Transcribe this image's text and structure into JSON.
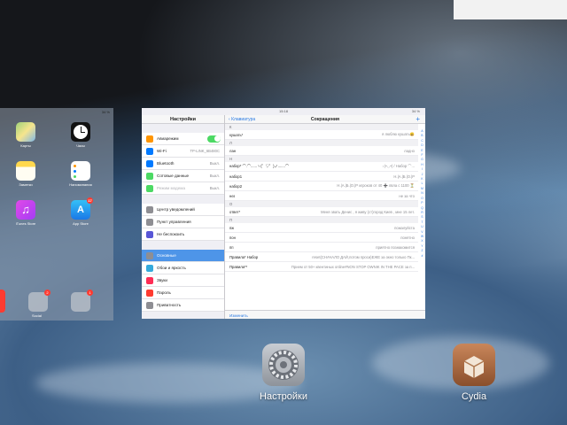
{
  "home_preview": {
    "status_time": "34 %",
    "apps": [
      {
        "label": "Карты",
        "icon": "maps-icon"
      },
      {
        "label": "Часы",
        "icon": "clock-icon"
      },
      {
        "label": "Заметки",
        "icon": "notes-icon"
      },
      {
        "label": "Напоминания",
        "icon": "reminders-icon"
      },
      {
        "label": "iTunes Store",
        "icon": "itunes-icon"
      },
      {
        "label": "App Store",
        "icon": "appstore-icon",
        "badge": "17"
      }
    ],
    "folders": [
      {
        "label": "Social",
        "badge": "2"
      },
      {
        "label": "",
        "badge": "1"
      }
    ]
  },
  "settings_preview": {
    "status_time": "15:18",
    "status_right": "34 %",
    "sidebar_title": "Настройки",
    "groups": [
      [
        {
          "label": "Авиарежим",
          "value": "",
          "toggle": true,
          "color": "#ff9500"
        },
        {
          "label": "Wi-Fi",
          "value": "TP-LINK_6B480C",
          "color": "#007aff"
        },
        {
          "label": "Bluetooth",
          "value": "Выкл.",
          "color": "#007aff"
        },
        {
          "label": "Сотовые данные",
          "value": "Выкл.",
          "color": "#4cd964"
        },
        {
          "label": "Режим модема",
          "value": "Выкл.",
          "color": "#4cd964",
          "dim": true
        }
      ],
      [
        {
          "label": "Центр уведомлений",
          "value": "",
          "color": "#8e8e93"
        },
        {
          "label": "Пункт управления",
          "value": "",
          "color": "#8e8e93"
        },
        {
          "label": "Не беспокоить",
          "value": "",
          "color": "#5856d6"
        }
      ],
      [
        {
          "label": "Основные",
          "value": "",
          "color": "#8e8e93",
          "active": true
        },
        {
          "label": "Обои и яркость",
          "value": "",
          "color": "#34aadc"
        },
        {
          "label": "Звуки",
          "value": "",
          "color": "#ff2d55"
        },
        {
          "label": "Пароль",
          "value": "",
          "color": "#ff3b30"
        },
        {
          "label": "Приватность",
          "value": "",
          "color": "#8e8e93"
        }
      ]
    ],
    "detail": {
      "back_label": "Клавиатура",
      "title": "Сокращения",
      "add_label": "+",
      "sections": [
        {
          "header": "К",
          "rows": [
            {
              "phrase": "кушать*",
              "shortcut": "я люблю кушать😀"
            }
          ]
        },
        {
          "header": "Л",
          "rows": [
            {
              "phrase": "лан",
              "shortcut": "ладно"
            }
          ]
        },
        {
          "header": "Н",
          "rows": [
            {
              "phrase": "набор* ⌒.⌒......ヽ(゜▽゜)ノ.......⌒",
              "shortcut": "\\ (•◡•) / Набор ⌒..."
            },
            {
              "phrase": "набор1",
              "shortcut": "Н.|А.|Б.|О.|Р"
            },
            {
              "phrase": "набор2",
              "shortcut": "Н.|А.|Б.|О.|Р игроков от 40 ➕ лвла с 1100 ⏳"
            },
            {
              "phrase": "нез",
              "shortcut": "не за что"
            }
          ]
        },
        {
          "header": "О",
          "rows": [
            {
              "phrase": "ответ*",
              "shortcut": "Меня звать Денис , я живу (ст)город Киев , мне 15 лет."
            }
          ]
        },
        {
          "header": "П",
          "rows": [
            {
              "phrase": "пж",
              "shortcut": "пожалуйста"
            },
            {
              "phrase": "пон",
              "shortcut": "понятно"
            },
            {
              "phrase": "пп",
              "shortcut": "приятно познакомится"
            },
            {
              "phrase": "Правила* Набор",
              "shortcut": "reset(СНАЧАЛО ДАЙ,потом проси)ЕЖЕ за окно только  Пк..."
            },
            {
              "phrase": "Правила**",
              "shortcut": "Прием от 50+ квентиных online#NON STOP OWNIK IN THE PACE за п..."
            }
          ]
        }
      ],
      "index_letters": [
        "A",
        "B",
        "C",
        "D",
        "E",
        "F",
        "G",
        "H",
        "I",
        "J",
        "K",
        "L",
        "M",
        "N",
        "O",
        "P",
        "Q",
        "R",
        "S",
        "T",
        "U",
        "V",
        "W",
        "X",
        "Y",
        "Z",
        "#"
      ],
      "edit_label": "Изменить"
    }
  },
  "dock": {
    "settings_label": "Настройки",
    "cydia_label": "Cydia"
  }
}
